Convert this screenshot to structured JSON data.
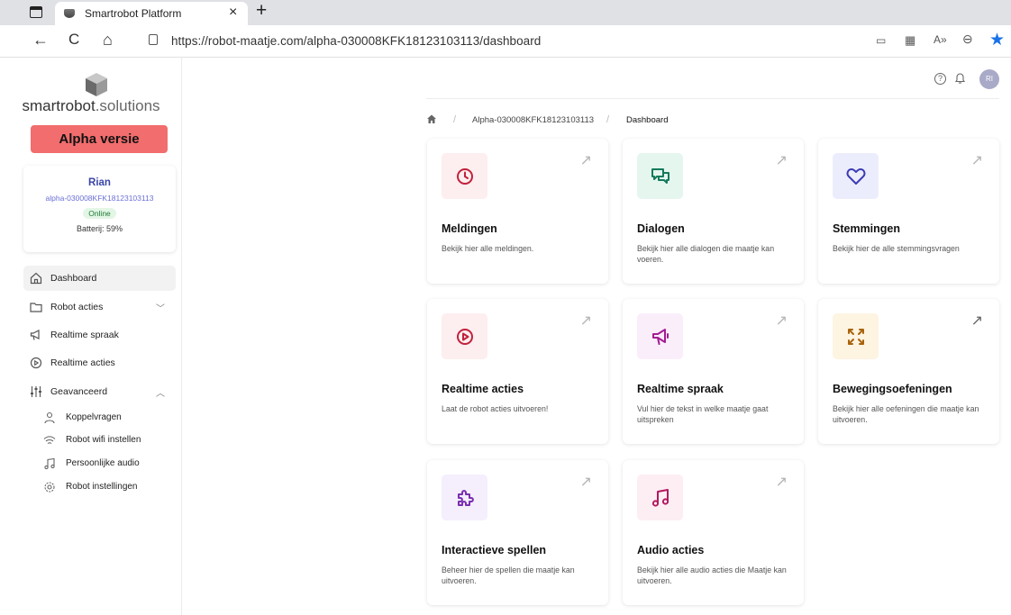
{
  "browser": {
    "tab_title": "Smartrobot Platform",
    "tab_close": "×",
    "new_tab": "+",
    "url": "https://robot-maatje.com/alpha-030008KFK18123103113/dashboard",
    "back": "←",
    "refresh": "C",
    "home": "⌂",
    "star": "★"
  },
  "sidebar": {
    "logo_bold": "smartrobot",
    "logo_light": ".solutions",
    "alpha_label": "Alpha versie",
    "profile": {
      "name": "Rian",
      "id": "alpha-030008KFK18123103113",
      "status": "Online",
      "battery": "Batterij: 59%"
    },
    "menu": [
      {
        "label": "Dashboard",
        "icon": "home-icon"
      },
      {
        "label": "Robot acties",
        "icon": "folder-icon"
      },
      {
        "label": "Realtime spraak",
        "icon": "megaphone-icon"
      },
      {
        "label": "Realtime acties",
        "icon": "play-icon"
      },
      {
        "label": "Geavanceerd",
        "icon": "sliders-icon"
      }
    ],
    "submenu": [
      {
        "label": "Koppelvragen",
        "icon": "users-icon"
      },
      {
        "label": "Robot wifi instellen",
        "icon": "wifi-icon"
      },
      {
        "label": "Persoonlijke audio",
        "icon": "music-icon"
      },
      {
        "label": "Robot instellingen",
        "icon": "gear-icon"
      }
    ]
  },
  "header": {
    "avatar_initials": "RI",
    "help_glyph": "?"
  },
  "breadcrumb": {
    "robot": "Alpha-030008KFK18123103113",
    "page": "Dashboard"
  },
  "cards": [
    {
      "title": "Meldingen",
      "desc": "Bekijk hier alle meldingen.",
      "icon": "clock-icon",
      "color": "#c0223a",
      "bg": "#fdeef0"
    },
    {
      "title": "Dialogen",
      "desc": "Bekijk hier alle dialogen die maatje kan voeren.",
      "icon": "chat-icon",
      "color": "#137a5b",
      "bg": "#e5f6ef"
    },
    {
      "title": "Stemmingen",
      "desc": "Bekijk hier de alle stemmingsvragen",
      "icon": "heart-icon",
      "color": "#3b3bb5",
      "bg": "#ecedfc"
    },
    {
      "title": "Realtime acties",
      "desc": "Laat de robot acties uitvoeren!",
      "icon": "play-circle-icon",
      "color": "#c0223a",
      "bg": "#fdeef0"
    },
    {
      "title": "Realtime spraak",
      "desc": "Vul hier de tekst in welke maatje gaat uitspreken",
      "icon": "megaphone-icon",
      "color": "#a31d94",
      "bg": "#fbeefb"
    },
    {
      "title": "Bewegingsoefeningen",
      "desc": "Bekijk hier alle oefeningen die maatje kan uitvoeren.",
      "icon": "expand-icon",
      "color": "#a8640c",
      "bg": "#fdf4e2"
    },
    {
      "title": "Interactieve spellen",
      "desc": "Beheer hier de spellen die maatje kan uitvoeren.",
      "icon": "puzzle-icon",
      "color": "#7a2fb0",
      "bg": "#f5eefc"
    },
    {
      "title": "Audio acties",
      "desc": "Bekijk hier alle audio acties die Maatje kan uitvoeren.",
      "icon": "music-icon",
      "color": "#b3195f",
      "bg": "#fdeef4"
    }
  ]
}
